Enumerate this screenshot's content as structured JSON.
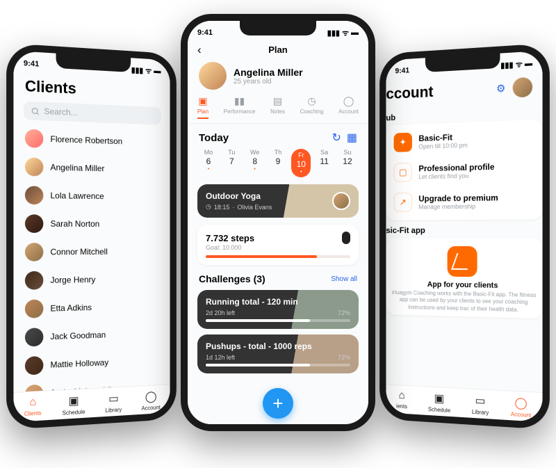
{
  "status_time": "9:41",
  "left": {
    "title": "Clients",
    "search_placeholder": "Search...",
    "clients": [
      "Florence Robertson",
      "Angelina Miller",
      "Lola Lawrence",
      "Sarah Norton",
      "Connor Mitchell",
      "Jorge Henry",
      "Etta Adkins",
      "Jack Goodman",
      "Mattie Holloway",
      "Jacky McLaughlin"
    ],
    "tabs": [
      "Clients",
      "Schedule",
      "Library",
      "Account"
    ],
    "active_tab": "Clients"
  },
  "center": {
    "header_title": "Plan",
    "profile_name": "Angelina Miller",
    "profile_age": "25 years old",
    "inner_tabs": [
      "Plan",
      "Performance",
      "Notes",
      "Coaching",
      "Account"
    ],
    "active_inner_tab": "Plan",
    "today_label": "Today",
    "week": [
      {
        "dow": "Mo",
        "day": "6",
        "dot": true
      },
      {
        "dow": "Tu",
        "day": "7",
        "dot": false
      },
      {
        "dow": "We",
        "day": "8",
        "dot": true
      },
      {
        "dow": "Th",
        "day": "9",
        "dot": false
      },
      {
        "dow": "Fr",
        "day": "10",
        "dot": true,
        "active": true
      },
      {
        "dow": "Sa",
        "day": "11",
        "dot": false
      },
      {
        "dow": "Su",
        "day": "12",
        "dot": false
      }
    ],
    "event": {
      "title": "Outdoor Yoga",
      "time": "18:15",
      "coach": "Olivia Evans"
    },
    "steps": {
      "value_text": "7.732 steps",
      "goal_text": "Goal: 10.000",
      "progress_pct": 77
    },
    "challenges_title": "Challenges (3)",
    "show_all": "Show all",
    "challenges": [
      {
        "title": "Running total - 120 min",
        "time_left": "2d 20h left",
        "pct_text": "72%",
        "pct": 72
      },
      {
        "title": "Pushups - total - 1000 reps",
        "time_left": "1d 12h left",
        "pct_text": "72%",
        "pct": 72
      }
    ]
  },
  "right": {
    "title_fragment": "ccount",
    "club_label_fragment": "ub",
    "items": [
      {
        "name": "Basic-Fit",
        "sub": "Open till 10:00 pm",
        "icon_type": "fill"
      },
      {
        "name": "Professional profile",
        "sub": "Let clients find you",
        "icon_type": "outline"
      },
      {
        "name": "Upgrade to premium",
        "sub": "Manage membership",
        "icon_type": "outline"
      }
    ],
    "app_section_label_fragment": "sic-Fit app",
    "app_title": "App for your clients",
    "app_desc": "irtuagym Coaching works with the Basic-Fit app. The fitness app can be used by your clients to see your coaching instructions and keep trac of their health data.",
    "tabs_fragment": [
      "ients",
      "Schedule",
      "Library",
      "Account"
    ],
    "active_tab": "Account"
  }
}
